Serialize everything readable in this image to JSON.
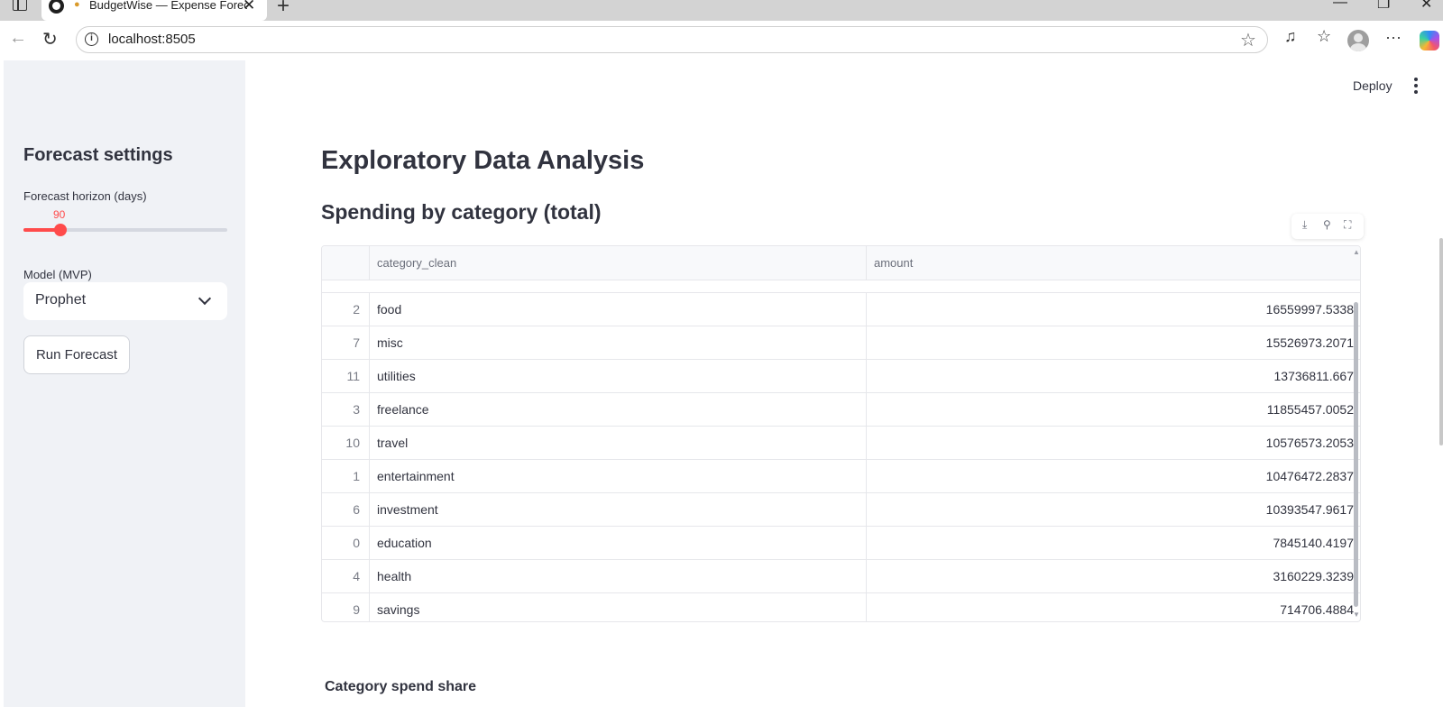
{
  "browser": {
    "tab_title": "BudgetWise — Expense Forec",
    "tab_close": "✕",
    "new_tab": "+",
    "url": "localhost:8505",
    "window_controls": [
      "—",
      "❐",
      "✕"
    ],
    "toolbar_icons": [
      "read-aloud-icon",
      "favorites-icon",
      "profile-icon",
      "more-icon",
      "copilot-icon"
    ]
  },
  "header": {
    "deploy_label": "Deploy"
  },
  "sidebar": {
    "title": "Forecast settings",
    "horizon_label": "Forecast horizon (days)",
    "horizon_value": "90",
    "horizon_fraction": 0.18,
    "model_label": "Model (MVP)",
    "model_selected": "Prophet",
    "run_button": "Run Forecast"
  },
  "main": {
    "title": "Exploratory Data Analysis",
    "subtitle": "Spending by category (total)",
    "section_share": "Category spend share",
    "table": {
      "columns": [
        "",
        "category_clean",
        "amount"
      ],
      "rows": [
        {
          "idx": "2",
          "category": "food",
          "amount": "16559997.5338"
        },
        {
          "idx": "7",
          "category": "misc",
          "amount": "15526973.2071"
        },
        {
          "idx": "11",
          "category": "utilities",
          "amount": "13736811.667"
        },
        {
          "idx": "3",
          "category": "freelance",
          "amount": "11855457.0052"
        },
        {
          "idx": "10",
          "category": "travel",
          "amount": "10576573.2053"
        },
        {
          "idx": "1",
          "category": "entertainment",
          "amount": "10476472.2837"
        },
        {
          "idx": "6",
          "category": "investment",
          "amount": "10393547.9617"
        },
        {
          "idx": "0",
          "category": "education",
          "amount": "7845140.4197"
        },
        {
          "idx": "4",
          "category": "health",
          "amount": "3160229.3239"
        },
        {
          "idx": "9",
          "category": "savings",
          "amount": "714706.4884"
        }
      ]
    },
    "table_toolbar": [
      "download-icon",
      "search-icon",
      "fullscreen-icon"
    ]
  },
  "colors": {
    "accent": "#ff4b4b",
    "sidebar_bg": "#f0f2f6",
    "text": "#31333f"
  }
}
